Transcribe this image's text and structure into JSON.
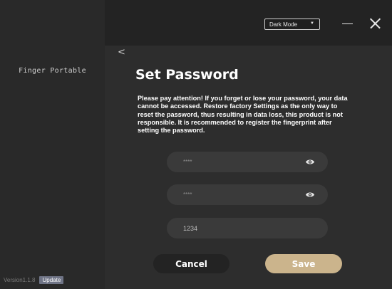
{
  "sidebar": {
    "app_name": "Finger Portable",
    "version": "Version1.1.8",
    "update_label": "Update"
  },
  "topbar": {
    "theme_select": {
      "selected": "Dark Mode",
      "caret": "▼"
    }
  },
  "page": {
    "back_glyph": "<",
    "title": "Set Password",
    "warning": "Please pay attention! If you forget or lose your password, your data cannot be accessed. Restore factory Settings as the only way to reset the password, thus resulting in data loss, this product is not responsible. It is recommended to register the fingerprint after setting the password.",
    "fields": [
      {
        "value": "****",
        "has_eye": true
      },
      {
        "value": "****",
        "has_eye": true
      },
      {
        "value": "1234",
        "has_eye": false
      }
    ],
    "cancel_label": "Cancel",
    "save_label": "Save"
  },
  "colors": {
    "accent": "#cbb48c",
    "background": "#2d2d2d",
    "sidebar": "#292929",
    "topbar": "#232323",
    "field": "#3a3a3a"
  },
  "icons": {
    "back": "chevron-left-icon",
    "eye": "eye-icon",
    "minimize": "minimize-icon",
    "close": "close-icon"
  }
}
